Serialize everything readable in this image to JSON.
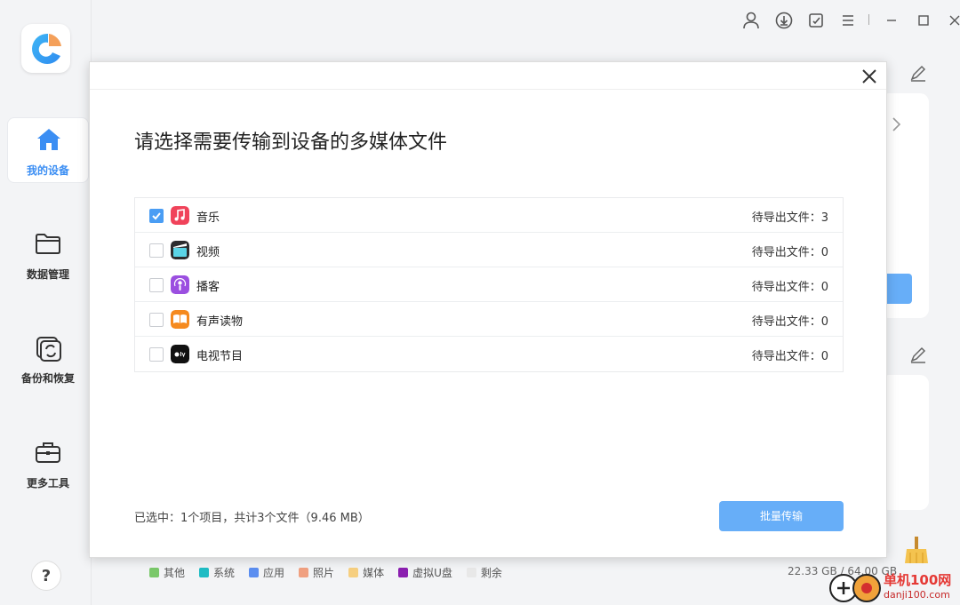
{
  "sidebar": {
    "items": [
      {
        "label": "我的设备"
      },
      {
        "label": "数据管理"
      },
      {
        "label": "备份和恢复"
      },
      {
        "label": "更多工具"
      }
    ],
    "help": "?"
  },
  "modal": {
    "title": "请选择需要传输到设备的多媒体文件",
    "rows": [
      {
        "label": "音乐",
        "count_text": "待导出文件：3",
        "checked": true,
        "icon": "music-icon"
      },
      {
        "label": "视频",
        "count_text": "待导出文件：0",
        "checked": false,
        "icon": "video-icon"
      },
      {
        "label": "播客",
        "count_text": "待导出文件：0",
        "checked": false,
        "icon": "podcast-icon"
      },
      {
        "label": "有声读物",
        "count_text": "待导出文件：0",
        "checked": false,
        "icon": "audiobook-icon"
      },
      {
        "label": "电视节目",
        "count_text": "待导出文件：0",
        "checked": false,
        "icon": "appletv-icon"
      }
    ],
    "summary": "已选中：1个项目，共计3个文件（9.46 MB）",
    "transfer_button": "批量传输"
  },
  "legend": [
    {
      "label": "其他",
      "color": "#7ac86a"
    },
    {
      "label": "系统",
      "color": "#1fbcc4"
    },
    {
      "label": "应用",
      "color": "#5b8ef0"
    },
    {
      "label": "照片",
      "color": "#f0a080"
    },
    {
      "label": "媒体",
      "color": "#f6cf80"
    },
    {
      "label": "虚拟U盘",
      "color": "#8b1fb0"
    },
    {
      "label": "剩余",
      "color": "#e8e8e8"
    }
  ],
  "storage": "22.33 GB / 64.00 GB",
  "watermark": {
    "title": "单机100网",
    "url": "danji100.com"
  }
}
